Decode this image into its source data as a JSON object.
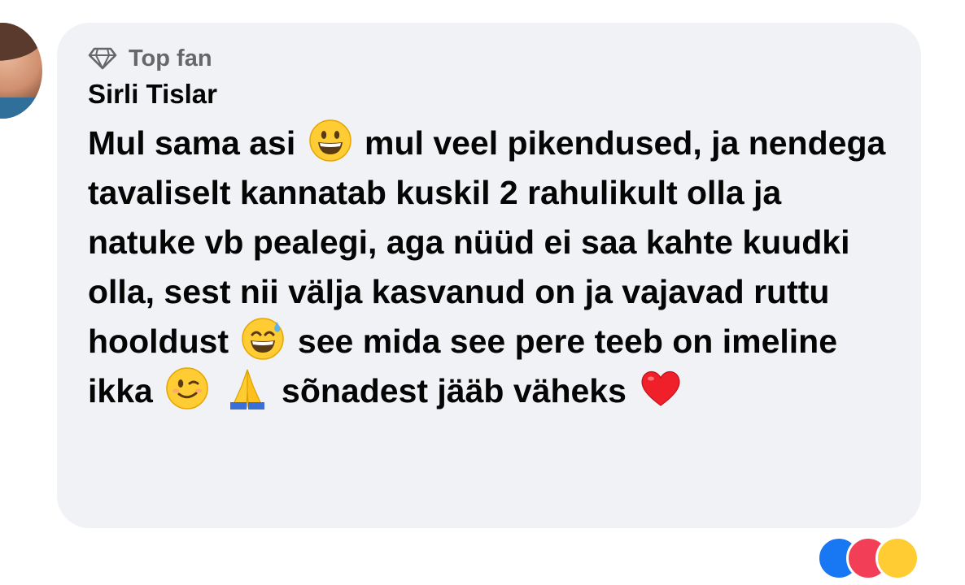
{
  "comment": {
    "badge_label": "Top fan",
    "author_name": "Sirli Tislar",
    "text_parts": {
      "p1": "Mul sama asi",
      "p2": "mul veel pikendused,  ja nendega tavaliselt kannatab kuskil 2 rahulikult olla ja natuke vb pealegi, aga nüüd ei saa kahte kuudki olla, sest nii välja kasvanud on ja vajavad ruttu hooldust",
      "p3": "see mida see pere teeb on imeline ikka",
      "p4": "sõnadest jääb väheks"
    },
    "emojis": [
      "grinning-face",
      "grinning-face-with-sweat",
      "winking-face",
      "folded-hands",
      "red-heart"
    ]
  },
  "colors": {
    "bubble_bg": "#f0f2f5",
    "text": "#050505",
    "muted": "#65676b",
    "like_blue": "#1877f2",
    "love_red": "#f33e58"
  }
}
